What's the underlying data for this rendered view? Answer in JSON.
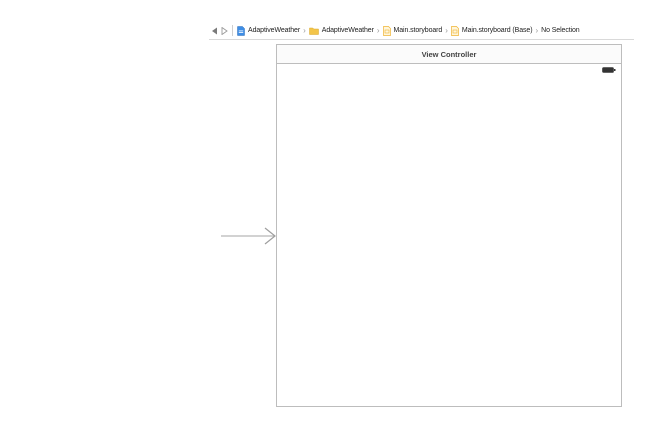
{
  "jump_bar": {
    "back_icon": "chevron-left-icon",
    "forward_icon": "chevron-right-icon",
    "breadcrumbs": [
      {
        "label": "AdaptiveWeather",
        "icon": "xcode-project-icon"
      },
      {
        "label": "AdaptiveWeather",
        "icon": "folder-icon"
      },
      {
        "label": "Main.storyboard",
        "icon": "storyboard-file-icon"
      },
      {
        "label": "Main.storyboard (Base)",
        "icon": "storyboard-file-icon"
      },
      {
        "label": "No Selection"
      }
    ]
  },
  "scene": {
    "title": "View Controller",
    "status_bar_icon": "battery-icon"
  },
  "entry_point_icon": "initial-view-controller-arrow-icon",
  "colors": {
    "folder": "#f3c54a",
    "project": "#3e8ee6",
    "storyboard": "#f0b432",
    "border": "#bdbdbd",
    "arrow": "#b8b8b8"
  }
}
